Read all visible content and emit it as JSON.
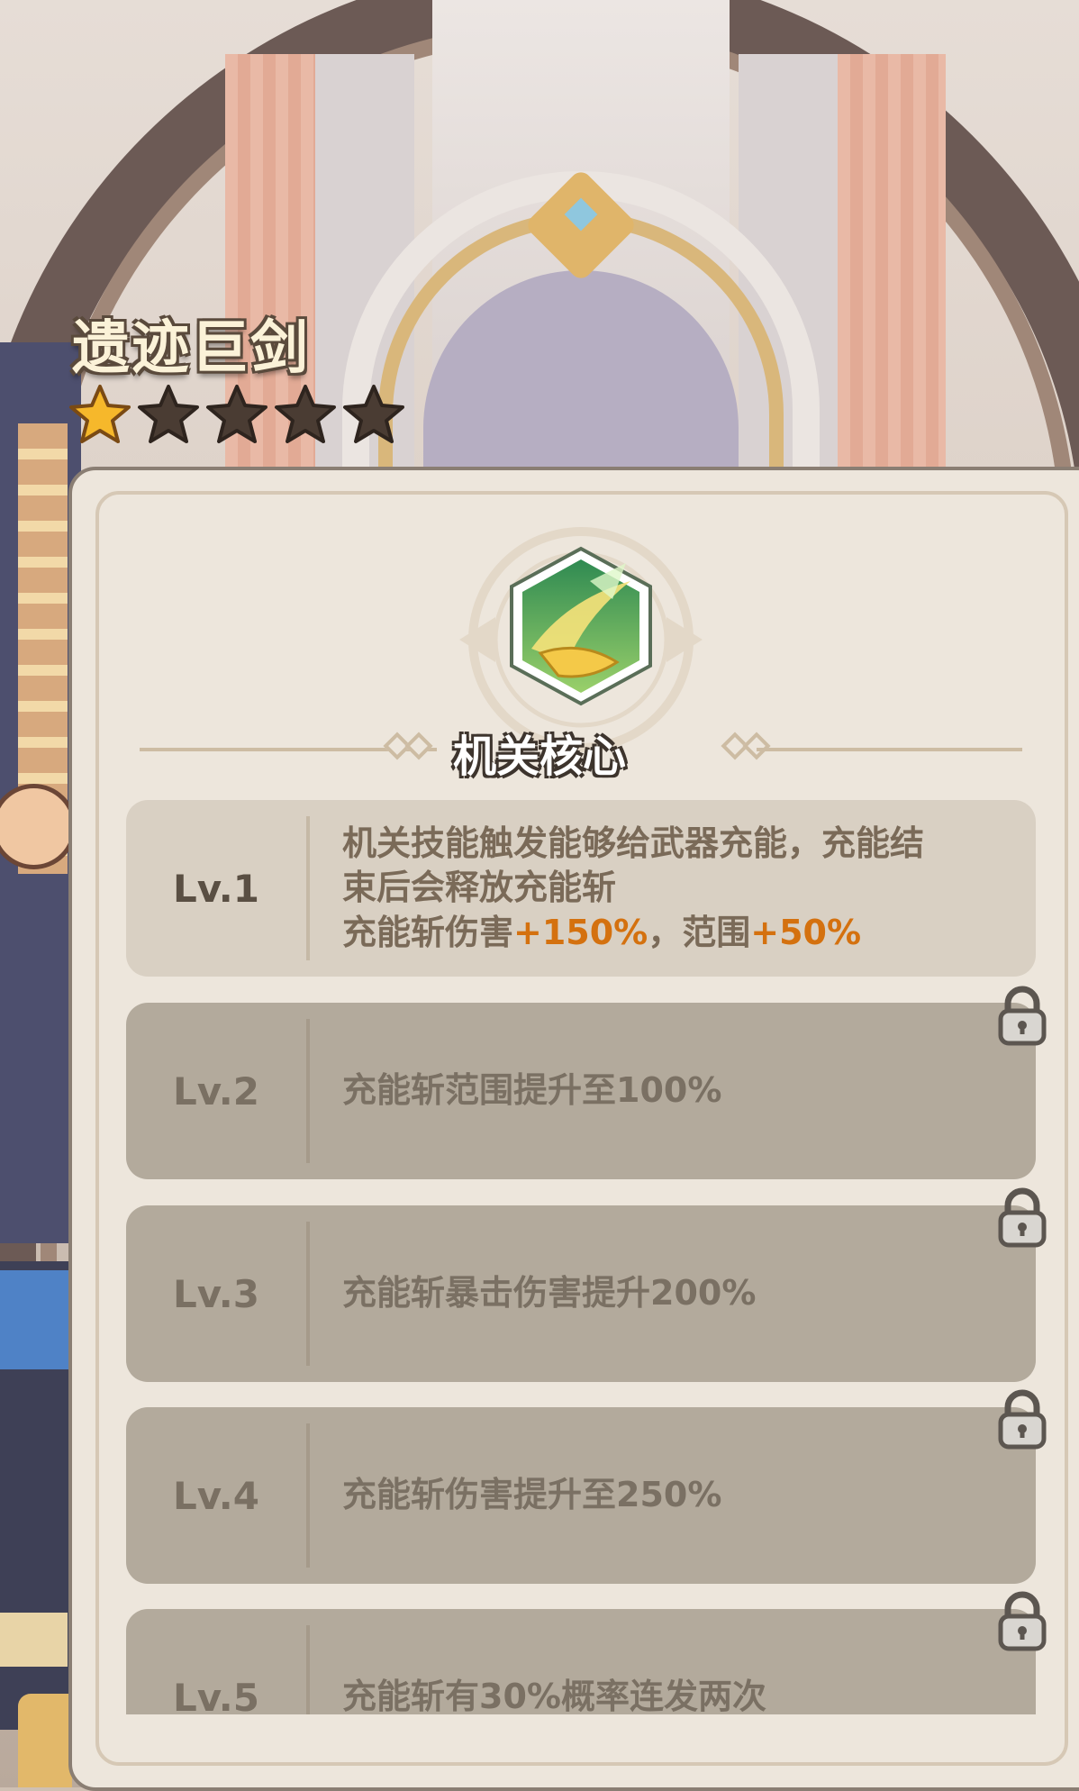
{
  "weapon": {
    "name": "遗迹巨剑",
    "stars_filled": 1,
    "stars_total": 5
  },
  "skill": {
    "name": "机关核心",
    "icon": "sword-slash-skill-icon"
  },
  "levels": [
    {
      "label": "Lv.1",
      "unlocked": true,
      "desc_line1": "机关技能触发能够给武器充能，充能结",
      "desc_line2": "束后会释放充能斩",
      "desc_line3_a": "充能斩伤害",
      "desc_line3_b": "+150%",
      "desc_line3_c": "，范围",
      "desc_line3_d": "+50%"
    },
    {
      "label": "Lv.2",
      "unlocked": false,
      "desc": "充能斩范围提升至100%"
    },
    {
      "label": "Lv.3",
      "unlocked": false,
      "desc": "充能斩暴击伤害提升200%"
    },
    {
      "label": "Lv.4",
      "unlocked": false,
      "desc": "充能斩伤害提升至250%"
    },
    {
      "label": "Lv.5",
      "unlocked": false,
      "desc": "充能斩有30%概率连发两次"
    }
  ],
  "colors": {
    "highlight": "#d4710f",
    "panel_bg": "#ede6dc",
    "unlocked_row": "#d9d0c3",
    "locked_row": "#b3aa9c",
    "star_filled": "#f6b82b",
    "star_empty": "#4a3c33"
  }
}
